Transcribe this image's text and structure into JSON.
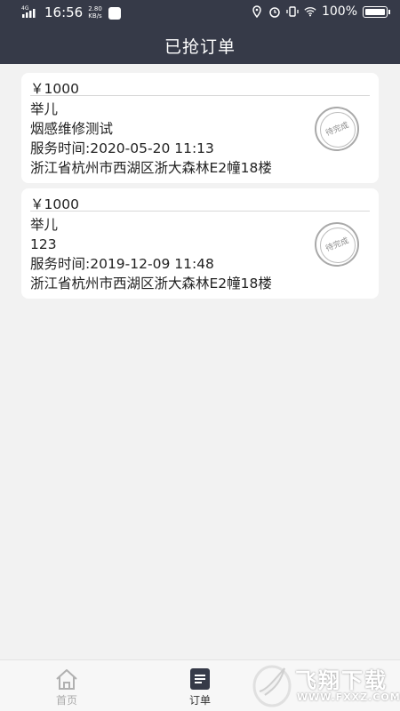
{
  "status_bar": {
    "network": "4G",
    "time": "16:56",
    "speed_value": "2.80",
    "speed_unit": "KB/s",
    "battery": "100%"
  },
  "header": {
    "title": "已抢订单"
  },
  "orders": [
    {
      "price": "￥1000",
      "customer": "举儿",
      "description": "烟感维修测试",
      "service_time": "服务时间:2020-05-20 11:13",
      "address": "浙江省杭州市西湖区浙大森林E2幢18楼",
      "status_stamp": "待完成"
    },
    {
      "price": "￥1000",
      "customer": "举儿",
      "description": "123",
      "service_time": "服务时间:2019-12-09 11:48",
      "address": "浙江省杭州市西湖区浙大森林E2幢18楼",
      "status_stamp": "待完成"
    }
  ],
  "tabbar": {
    "home_label": "首页",
    "orders_label": "订单"
  },
  "watermark": {
    "brand": "飞翔下载",
    "url": "WWW.FXXZ.COM"
  },
  "colors": {
    "header_bg": "#363a48",
    "page_bg": "#f2f2f2",
    "card_bg": "#ffffff"
  }
}
